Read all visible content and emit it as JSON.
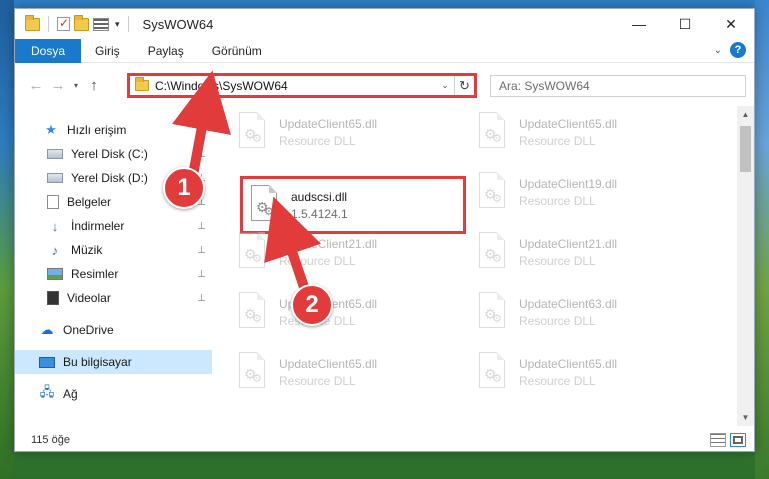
{
  "window": {
    "title": "SysWOW64",
    "minimize_glyph": "—",
    "maximize_glyph": "☐",
    "close_glyph": "✕"
  },
  "ribbon": {
    "tabs": [
      "Dosya",
      "Giriş",
      "Paylaş",
      "Görünüm"
    ],
    "expand_glyph": "⌄",
    "help_glyph": "?"
  },
  "nav": {
    "back_glyph": "←",
    "forward_glyph": "→",
    "recent_glyph": "▾",
    "up_glyph": "↑",
    "address": "C:\\Windows\\SysWOW64",
    "address_drop_glyph": "⌄",
    "refresh_glyph": "↻",
    "search_placeholder": "Ara: SysWOW64"
  },
  "sidebar": {
    "items": [
      {
        "label": "Hızlı erişim",
        "icon": "star-icon"
      },
      {
        "label": "Yerel Disk (C:)",
        "icon": "drive-icon",
        "pinned": true
      },
      {
        "label": "Yerel Disk (D:)",
        "icon": "drive-icon",
        "pinned": true
      },
      {
        "label": "Belgeler",
        "icon": "documents-icon",
        "pinned": true
      },
      {
        "label": "İndirmeler",
        "icon": "downloads-icon",
        "pinned": true
      },
      {
        "label": "Müzik",
        "icon": "music-icon",
        "pinned": true
      },
      {
        "label": "Resimler",
        "icon": "pictures-icon",
        "pinned": true
      },
      {
        "label": "Videolar",
        "icon": "videos-icon",
        "pinned": true
      },
      {
        "label": "OneDrive",
        "icon": "cloud-icon"
      },
      {
        "label": "Bu bilgisayar",
        "icon": "computer-icon",
        "selected": true
      },
      {
        "label": "Ağ",
        "icon": "network-icon"
      }
    ],
    "pin_glyph": "📌"
  },
  "files": {
    "highlighted": {
      "name": "audscsi.dll",
      "version": "1.5.4124.1"
    },
    "ghost": [
      {
        "name": "UpdateClient65.dll",
        "type": "Resource DLL"
      },
      {
        "name": "UpdateClient65.dll",
        "type": "Resource DLL"
      },
      {
        "name": "UpdateClient19.dll",
        "type": "Resource DLL"
      },
      {
        "name": "UpdateClient21.dll",
        "type": "Resource DLL"
      },
      {
        "name": "UpdateClient21.dll",
        "type": "Resource DLL"
      },
      {
        "name": "UpdateClient65.dll",
        "type": "Resource DLL"
      },
      {
        "name": "UpdateClient63.dll",
        "type": "Resource DLL"
      },
      {
        "name": "UpdateClient65.dll",
        "type": "Resource DLL"
      },
      {
        "name": "UpdateClient65.dll",
        "type": "Resource DLL"
      }
    ]
  },
  "status": {
    "count": "115 öğe"
  },
  "annotations": {
    "step1": "1",
    "step2": "2",
    "color": "#e23b3b"
  }
}
